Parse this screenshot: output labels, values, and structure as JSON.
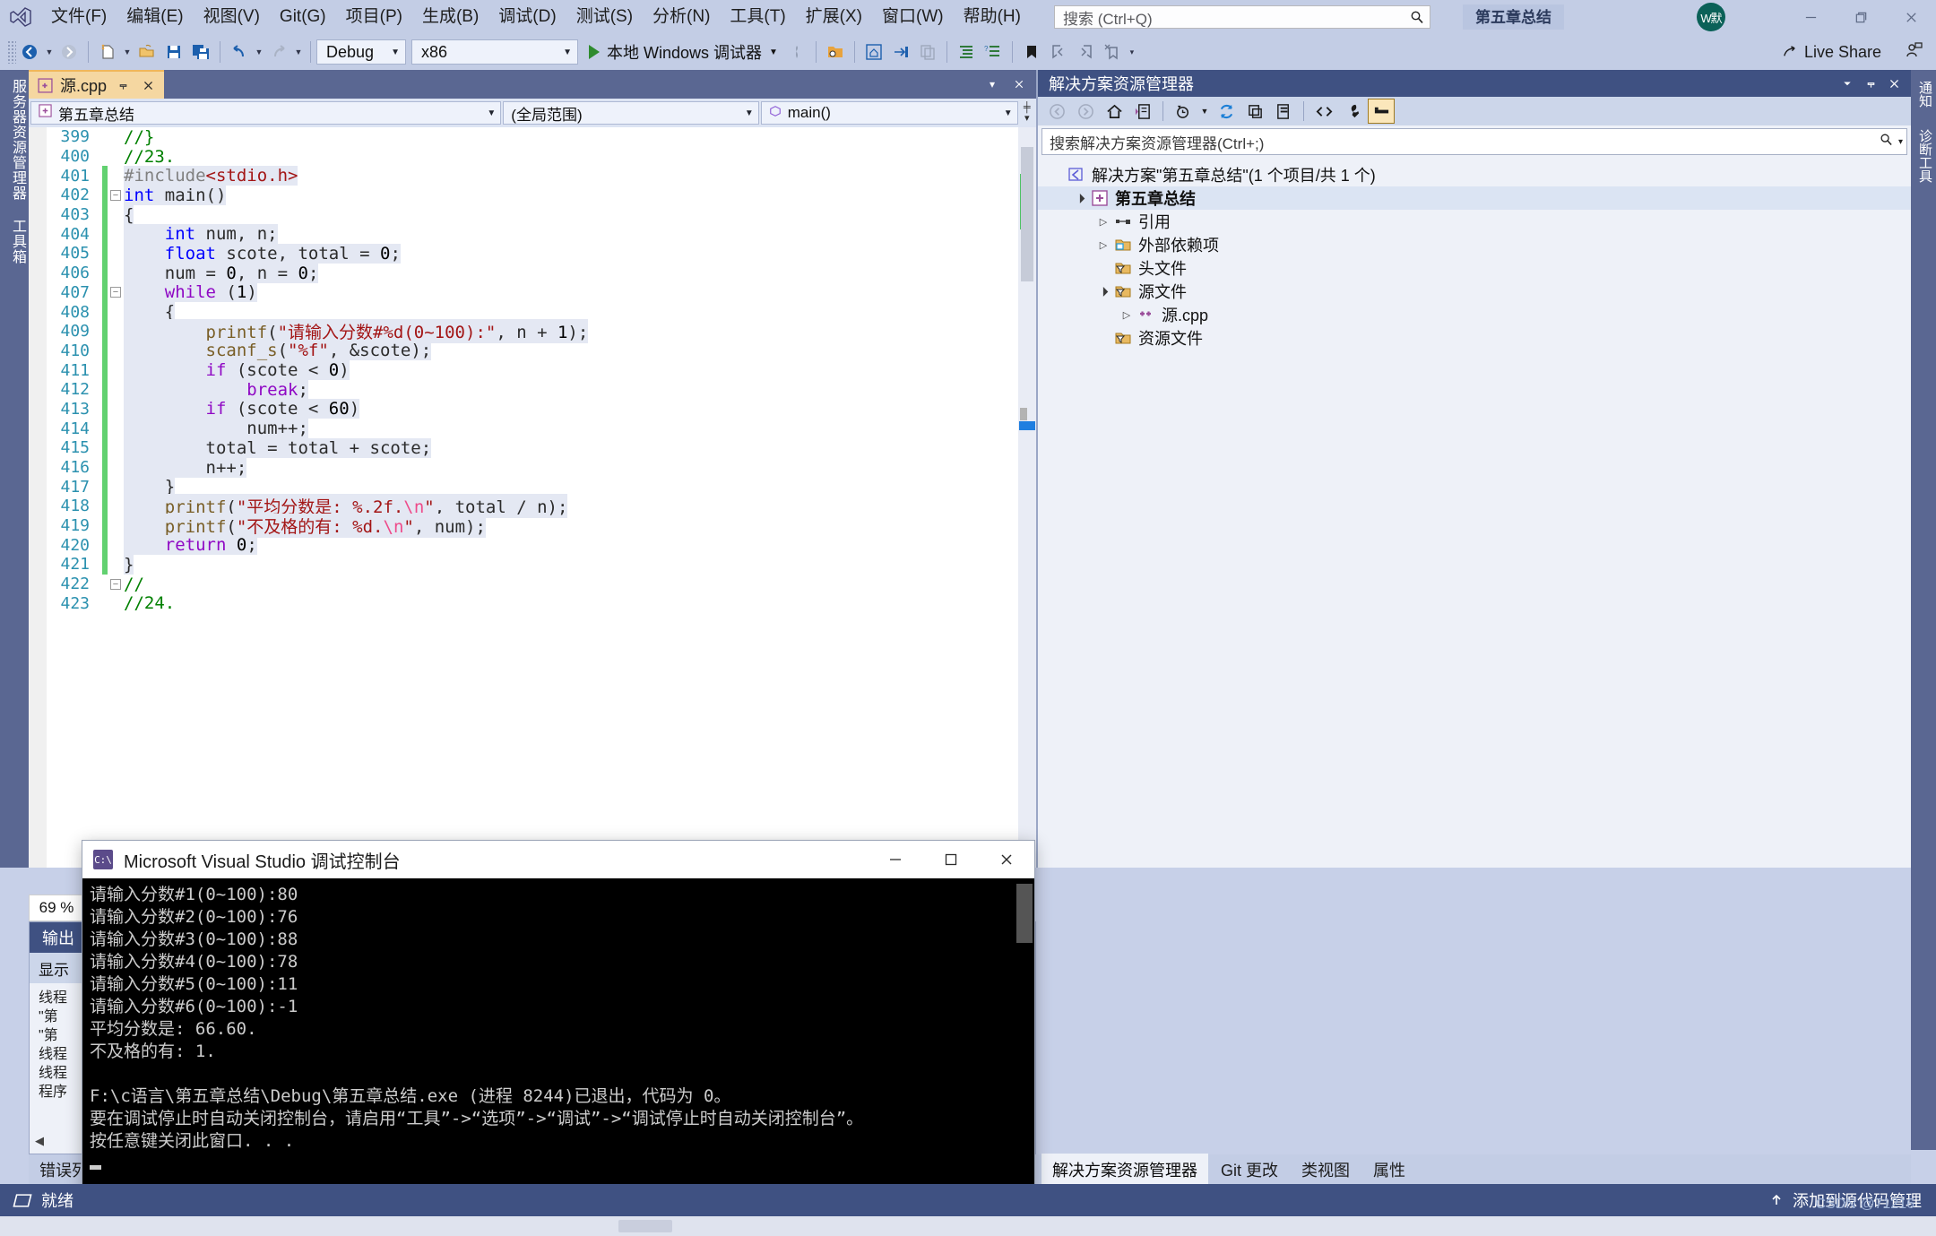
{
  "titlebar": {
    "menu": [
      "文件(F)",
      "编辑(E)",
      "视图(V)",
      "Git(G)",
      "项目(P)",
      "生成(B)",
      "调试(D)",
      "测试(S)",
      "分析(N)",
      "工具(T)",
      "扩展(X)",
      "窗口(W)",
      "帮助(H)"
    ],
    "search_placeholder": "搜索 (Ctrl+Q)",
    "project_chip": "第五章总结",
    "account_initials": "W默",
    "minimize": "—",
    "restore": "❐",
    "close": "✕"
  },
  "toolbar": {
    "config": "Debug",
    "platform": "x86",
    "run_label": "本地 Windows 调试器",
    "live_share": "Live Share"
  },
  "left_tabs": [
    "服务器资源管理器",
    "工具箱"
  ],
  "right_tabs": [
    "通知",
    "诊断工具"
  ],
  "editor": {
    "tab_label": "源.cpp",
    "nav_project": "第五章总结",
    "nav_scope": "(全局范围)",
    "nav_member": "main()",
    "zoom": "69 %",
    "lines": [
      {
        "n": "399",
        "change": "",
        "fold": "",
        "sel": false,
        "tokens": [
          {
            "t": "//}",
            "c": "cmt"
          }
        ],
        "indent": 0
      },
      {
        "n": "400",
        "change": "",
        "fold": "",
        "sel": false,
        "tokens": [
          {
            "t": "//23.",
            "c": "cmt"
          }
        ],
        "indent": 0
      },
      {
        "n": "401",
        "change": "g",
        "fold": "",
        "sel": true,
        "tokens": [
          {
            "t": "#include",
            "c": "pp"
          },
          {
            "t": "<stdio.h>",
            "c": "inc"
          }
        ],
        "indent": 0
      },
      {
        "n": "402",
        "change": "g",
        "fold": "-",
        "sel": true,
        "tokens": [
          {
            "t": "int",
            "c": "kw"
          },
          {
            "t": " main()",
            "c": "idn"
          }
        ],
        "indent": 0
      },
      {
        "n": "403",
        "change": "g",
        "fold": "",
        "sel": true,
        "tokens": [
          {
            "t": "{",
            "c": "idn"
          }
        ],
        "indent": 0
      },
      {
        "n": "404",
        "change": "g",
        "fold": "",
        "sel": true,
        "tokens": [
          {
            "t": "    ",
            "c": "idn"
          },
          {
            "t": "int",
            "c": "kw"
          },
          {
            "t": " num, n;",
            "c": "idn"
          }
        ],
        "indent": 0
      },
      {
        "n": "405",
        "change": "g",
        "fold": "",
        "sel": true,
        "tokens": [
          {
            "t": "    ",
            "c": "idn"
          },
          {
            "t": "float",
            "c": "kw"
          },
          {
            "t": " scote, total = ",
            "c": "idn"
          },
          {
            "t": "0",
            "c": "num"
          },
          {
            "t": ";",
            "c": "idn"
          }
        ],
        "indent": 0
      },
      {
        "n": "406",
        "change": "g",
        "fold": "",
        "sel": true,
        "tokens": [
          {
            "t": "    num = ",
            "c": "idn"
          },
          {
            "t": "0",
            "c": "num"
          },
          {
            "t": ", n = ",
            "c": "idn"
          },
          {
            "t": "0",
            "c": "num"
          },
          {
            "t": ";",
            "c": "idn"
          }
        ],
        "indent": 0
      },
      {
        "n": "407",
        "change": "g",
        "fold": "-",
        "sel": true,
        "tokens": [
          {
            "t": "    ",
            "c": "idn"
          },
          {
            "t": "while",
            "c": "kw2"
          },
          {
            "t": " (",
            "c": "idn"
          },
          {
            "t": "1",
            "c": "num"
          },
          {
            "t": ")",
            "c": "idn"
          }
        ],
        "indent": 0
      },
      {
        "n": "408",
        "change": "g",
        "fold": "",
        "sel": true,
        "tokens": [
          {
            "t": "    {",
            "c": "idn"
          }
        ],
        "indent": 0
      },
      {
        "n": "409",
        "change": "g",
        "fold": "",
        "sel": true,
        "tokens": [
          {
            "t": "        ",
            "c": "idn"
          },
          {
            "t": "printf",
            "c": "fn"
          },
          {
            "t": "(",
            "c": "idn"
          },
          {
            "t": "\"请输入分数#%d(0~100):\"",
            "c": "str"
          },
          {
            "t": ", n + ",
            "c": "idn"
          },
          {
            "t": "1",
            "c": "num"
          },
          {
            "t": ");",
            "c": "idn"
          }
        ],
        "indent": 0
      },
      {
        "n": "410",
        "change": "g",
        "fold": "",
        "sel": true,
        "tokens": [
          {
            "t": "        ",
            "c": "idn"
          },
          {
            "t": "scanf_s",
            "c": "fn"
          },
          {
            "t": "(",
            "c": "idn"
          },
          {
            "t": "\"%f\"",
            "c": "str"
          },
          {
            "t": ", &scote);",
            "c": "idn"
          }
        ],
        "indent": 0
      },
      {
        "n": "411",
        "change": "g",
        "fold": "",
        "sel": true,
        "tokens": [
          {
            "t": "        ",
            "c": "idn"
          },
          {
            "t": "if",
            "c": "kw2"
          },
          {
            "t": " (scote < ",
            "c": "idn"
          },
          {
            "t": "0",
            "c": "num"
          },
          {
            "t": ")",
            "c": "idn"
          }
        ],
        "indent": 0
      },
      {
        "n": "412",
        "change": "g",
        "fold": "",
        "sel": true,
        "tokens": [
          {
            "t": "            ",
            "c": "idn"
          },
          {
            "t": "break",
            "c": "kw2"
          },
          {
            "t": ";",
            "c": "idn"
          }
        ],
        "indent": 0
      },
      {
        "n": "413",
        "change": "g",
        "fold": "",
        "sel": true,
        "tokens": [
          {
            "t": "        ",
            "c": "idn"
          },
          {
            "t": "if",
            "c": "kw2"
          },
          {
            "t": " (scote < ",
            "c": "idn"
          },
          {
            "t": "60",
            "c": "num"
          },
          {
            "t": ")",
            "c": "idn"
          }
        ],
        "indent": 0
      },
      {
        "n": "414",
        "change": "g",
        "fold": "",
        "sel": true,
        "tokens": [
          {
            "t": "            num++;",
            "c": "idn"
          }
        ],
        "indent": 0
      },
      {
        "n": "415",
        "change": "g",
        "fold": "",
        "sel": true,
        "tokens": [
          {
            "t": "        total = total + scote;",
            "c": "idn"
          }
        ],
        "indent": 0
      },
      {
        "n": "416",
        "change": "g",
        "fold": "",
        "sel": true,
        "tokens": [
          {
            "t": "        n++;",
            "c": "idn"
          }
        ],
        "indent": 0
      },
      {
        "n": "417",
        "change": "g",
        "fold": "",
        "sel": true,
        "tokens": [
          {
            "t": "    }",
            "c": "idn"
          }
        ],
        "indent": 0
      },
      {
        "n": "418",
        "change": "g",
        "fold": "",
        "sel": true,
        "tokens": [
          {
            "t": "    ",
            "c": "idn"
          },
          {
            "t": "printf",
            "c": "fn"
          },
          {
            "t": "(",
            "c": "idn"
          },
          {
            "t": "\"平均分数是: %.2f.",
            "c": "str"
          },
          {
            "t": "\\n",
            "c": "esc"
          },
          {
            "t": "\"",
            "c": "str"
          },
          {
            "t": ", total / n);",
            "c": "idn"
          }
        ],
        "indent": 0
      },
      {
        "n": "419",
        "change": "g",
        "fold": "",
        "sel": true,
        "tokens": [
          {
            "t": "    ",
            "c": "idn"
          },
          {
            "t": "printf",
            "c": "fn"
          },
          {
            "t": "(",
            "c": "idn"
          },
          {
            "t": "\"不及格的有: %d.",
            "c": "str"
          },
          {
            "t": "\\n",
            "c": "esc"
          },
          {
            "t": "\"",
            "c": "str"
          },
          {
            "t": ", num);",
            "c": "idn"
          }
        ],
        "indent": 0
      },
      {
        "n": "420",
        "change": "g",
        "fold": "",
        "sel": true,
        "tokens": [
          {
            "t": "    ",
            "c": "idn"
          },
          {
            "t": "return",
            "c": "kw2"
          },
          {
            "t": " ",
            "c": "idn"
          },
          {
            "t": "0",
            "c": "num"
          },
          {
            "t": ";",
            "c": "idn"
          }
        ],
        "indent": 0
      },
      {
        "n": "421",
        "change": "g",
        "fold": "",
        "sel": true,
        "tokens": [
          {
            "t": "}",
            "c": "idn"
          }
        ],
        "indent": 0
      },
      {
        "n": "422",
        "change": "",
        "fold": "-",
        "sel": false,
        "tokens": [
          {
            "t": "//",
            "c": "cmt"
          }
        ],
        "indent": 0
      },
      {
        "n": "423",
        "change": "",
        "fold": "",
        "sel": false,
        "tokens": [
          {
            "t": "//24.",
            "c": "cmt"
          }
        ],
        "indent": 0
      }
    ]
  },
  "solution_explorer": {
    "title": "解决方案资源管理器",
    "search_placeholder": "搜索解决方案资源管理器(Ctrl+;)",
    "tree": [
      {
        "level": 0,
        "twisty": "",
        "icon": "solution-icon",
        "label": "解决方案\"第五章总结\"(1 个项目/共 1 个)",
        "bold": false
      },
      {
        "level": 1,
        "twisty": "▾",
        "icon": "project-icon",
        "label": "第五章总结",
        "bold": true
      },
      {
        "level": 2,
        "twisty": "▸",
        "icon": "references-icon",
        "label": "引用",
        "bold": false
      },
      {
        "level": 2,
        "twisty": "▸",
        "icon": "external-deps-icon",
        "label": "外部依赖项",
        "bold": false
      },
      {
        "level": 2,
        "twisty": "",
        "icon": "filter-folder-icon",
        "label": "头文件",
        "bold": false
      },
      {
        "level": 2,
        "twisty": "▾",
        "icon": "filter-folder-icon",
        "label": "源文件",
        "bold": false
      },
      {
        "level": 3,
        "twisty": "▸",
        "icon": "cpp-file-icon",
        "label": "源.cpp",
        "bold": false
      },
      {
        "level": 2,
        "twisty": "",
        "icon": "filter-folder-icon",
        "label": "资源文件",
        "bold": false
      }
    ],
    "bottom_tabs": [
      "解决方案资源管理器",
      "Git 更改",
      "类视图",
      "属性"
    ],
    "bottom_tab_active": "解决方案资源管理器"
  },
  "output_panel": {
    "tab": "输出",
    "show_label": "显示",
    "lines": [
      "线程",
      "\"第",
      "\"第",
      "线程",
      "线程",
      "程序"
    ],
    "error_tab": "错误列表"
  },
  "console": {
    "title": "Microsoft Visual Studio 调试控制台",
    "minimize": "—",
    "maximize": "□",
    "close": "✕",
    "lines": [
      "请输入分数#1(0~100):80",
      "请输入分数#2(0~100):76",
      "请输入分数#3(0~100):88",
      "请输入分数#4(0~100):78",
      "请输入分数#5(0~100):11",
      "请输入分数#6(0~100):-1",
      "平均分数是: 66.60.",
      "不及格的有: 1.",
      "",
      "F:\\c语言\\第五章总结\\Debug\\第五章总结.exe (进程 8244)已退出，代码为 0。",
      "要在调试停止时自动关闭控制台，请启用“工具”->“选项”->“调试”->“调试停止时自动关闭控制台”。",
      "按任意键关闭此窗口. . ."
    ]
  },
  "statusbar": {
    "ready": "就绪",
    "source_control": "添加到源代码管理",
    "watermark": "CSDN @71216"
  }
}
